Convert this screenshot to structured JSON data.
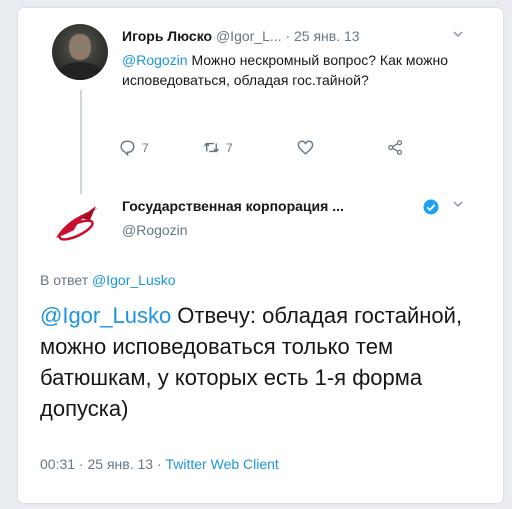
{
  "reply_tweet": {
    "author_name": "Игорь Люско",
    "author_handle": "@Igor_L...",
    "date": "· 25 янв. 13",
    "mention": "@Rogozin",
    "text": " Можно нескромный вопрос? Как можно исповедоваться, обладая гос.тайной?",
    "reply_count": "7",
    "retweet_count": "7"
  },
  "main_tweet": {
    "author_name": "Государственная корпорация ...",
    "author_handle": "@Rogozin",
    "reply_prefix": "В ответ ",
    "reply_target": "@Igor_Lusko",
    "mention": "@Igor_Lusko",
    "text": " Отвечу: обладая гостайной, можно исповедоваться только тем батюшкам, у которых есть 1-я форма допуска)",
    "time": "00:31 · 25 янв. 13 · ",
    "client": "Twitter Web Client"
  },
  "icons": [
    "reply-icon",
    "retweet-icon",
    "like-icon",
    "share-icon",
    "verified-icon",
    "chevron-down-icon"
  ],
  "colors": {
    "link": "#1b95e0",
    "muted": "#657786",
    "verified": "#1da1f2",
    "logo_red": "#c8102e"
  }
}
